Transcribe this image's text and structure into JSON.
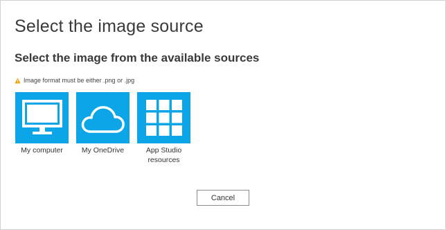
{
  "dialog": {
    "title": "Select the image source",
    "subtitle": "Select the image from the available sources",
    "warning": {
      "icon": "warning-icon",
      "text": "Image format must be either .png or .jpg",
      "icon_color": "#f0a30a"
    },
    "tiles": [
      {
        "label": "My computer",
        "icon": "monitor-icon"
      },
      {
        "label": "My OneDrive",
        "icon": "cloud-icon"
      },
      {
        "label": "App Studio resources",
        "icon": "grid-icon"
      }
    ],
    "tile_color": "#0ca6e8",
    "cancel_label": "Cancel"
  }
}
